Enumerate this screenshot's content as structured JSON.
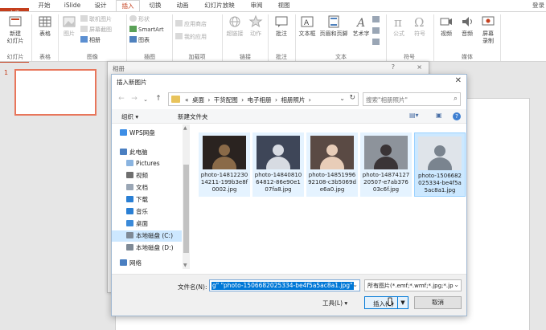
{
  "ribbon": {
    "tabs": [
      "文件",
      "开始",
      "iSlide",
      "设计",
      "插入",
      "切换",
      "动画",
      "幻灯片放映",
      "审阅",
      "视图"
    ],
    "active_tab": "插入",
    "user": "登录",
    "groups": {
      "slides": {
        "label": "幻灯片",
        "new_slide": "新建\n幻灯片"
      },
      "table": {
        "label": "表格",
        "table": "表格"
      },
      "images": {
        "label": "图像",
        "picture": "图片",
        "online_picture": "联机图片",
        "screenshot": "屏幕截图",
        "album": "相册"
      },
      "illustrations": {
        "label": "插图",
        "shapes": "形状",
        "smartart": "SmartArt",
        "chart": "图表"
      },
      "addins": {
        "label": "加载项",
        "store": "应用商店",
        "my_addins": "我的应用"
      },
      "links": {
        "label": "链接",
        "hyperlink": "超链接",
        "action": "动作"
      },
      "comments": {
        "label": "批注",
        "comment": "批注"
      },
      "text": {
        "label": "文本",
        "textbox": "文本框",
        "header_footer": "页眉和页脚",
        "wordart": "艺术字"
      },
      "symbols": {
        "label": "符号",
        "equation": "公式",
        "symbol": "符号"
      },
      "media": {
        "label": "媒体",
        "video": "视频",
        "audio": "音频",
        "screen_record": "屏幕\n录制"
      }
    }
  },
  "slides": {
    "current_number": "1"
  },
  "outer_dialog": {
    "title": "相册",
    "help": "?",
    "close": "×"
  },
  "dialog": {
    "title": "插入新图片",
    "close": "✕",
    "breadcrumbs": [
      "«",
      "桌面",
      "›",
      "干货配图",
      "›",
      "电子相册",
      "›",
      "相册照片",
      "›"
    ],
    "search_placeholder": "搜索\"相册照片\"",
    "organize": "组织 ▾",
    "new_folder": "新建文件夹",
    "nav_items": [
      {
        "label": "WPS网盘",
        "color": "#3d8ee6"
      },
      {
        "label": "此电脑",
        "color": "#4a7fc1"
      },
      {
        "label": "Pictures",
        "color": "#8ab4e0"
      },
      {
        "label": "视频",
        "color": "#6f6f6f"
      },
      {
        "label": "文档",
        "color": "#9aa6b5"
      },
      {
        "label": "下载",
        "color": "#2a7fd4"
      },
      {
        "label": "音乐",
        "color": "#2a7fd4"
      },
      {
        "label": "桌面",
        "color": "#3b8ad9"
      },
      {
        "label": "本地磁盘 (C:)",
        "color": "#7f8a96"
      },
      {
        "label": "本地磁盘 (D:)",
        "color": "#7f8a96"
      },
      {
        "label": "网络",
        "color": "#4a7fc1"
      }
    ],
    "selected_nav": "本地磁盘 (C:)",
    "files": [
      {
        "name": "photo-1481223014211-199b3e8f0002.jpg",
        "c1": "#2a2320",
        "c2": "#8a6a48"
      },
      {
        "name": "photo-1484081064812-86e90e107fa8.jpg",
        "c1": "#3e4658",
        "c2": "#d7dbe2"
      },
      {
        "name": "photo-1485199692108-c3b5069de6a0.jpg",
        "c1": "#5a4a44",
        "c2": "#e8cdb8"
      },
      {
        "name": "photo-1487412720507-e7ab37603c6f.jpg",
        "c1": "#8d939b",
        "c2": "#3a3436"
      },
      {
        "name": "photo-1506682025334-be4f5a5ac8a1.jpg",
        "c1": "#dfe4ea",
        "c2": "#7a848f"
      }
    ],
    "filename_label": "文件名(N):",
    "filename_value": "g\" \"photo-1506682025334-be4f5a5ac8a1.jpg\"",
    "filetype_value": "所有图片(*.emf;*.wmf;*.jpg;*.jp",
    "tools_label": "工具(L)",
    "insert_label": "插入(S)",
    "cancel_label": "取消"
  }
}
